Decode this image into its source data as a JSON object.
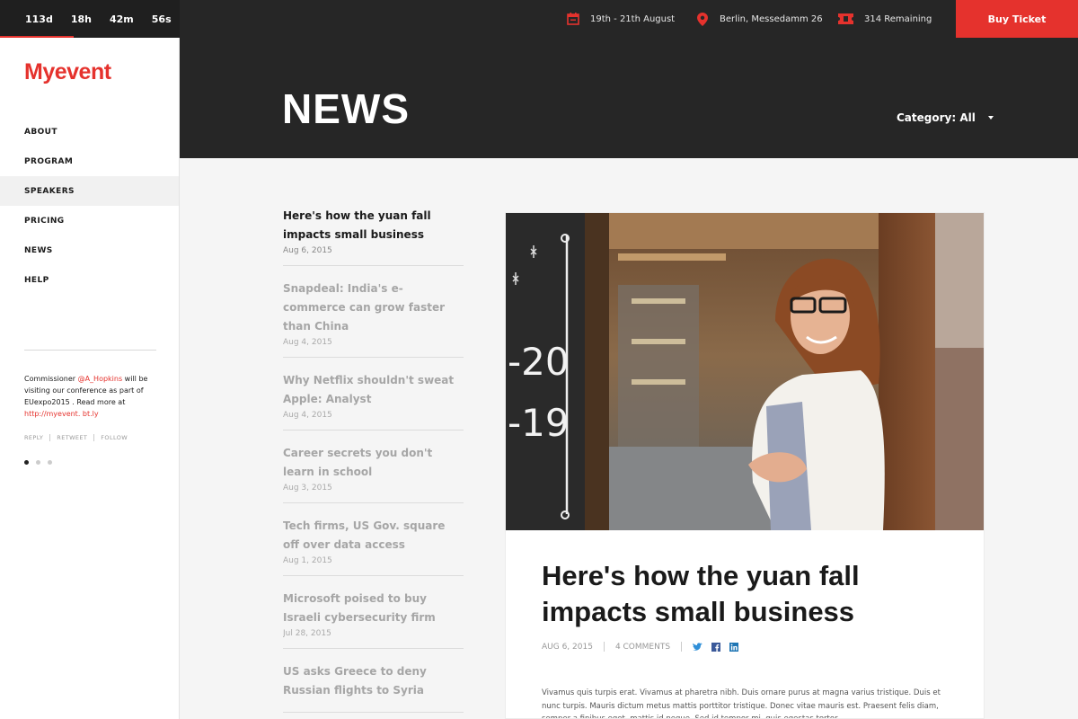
{
  "topbar": {
    "countdown": {
      "days": "113d",
      "hours": "18h",
      "minutes": "42m",
      "seconds": "56s"
    },
    "dates": "19th - 21th August",
    "location": "Berlin, Messedamm 26",
    "remaining": "314 Remaining",
    "buy_label": "Buy Ticket"
  },
  "sidebar": {
    "logo": {
      "part1": "My",
      "part2": "event"
    },
    "nav": [
      "ABOUT",
      "PROGRAM",
      "SPEAKERS",
      "PRICING",
      "NEWS",
      "HELP"
    ],
    "tweet": {
      "pre": "Commissioner ",
      "handle": "@A_Hopkins",
      "mid": " will be visiting our conference as part of EUexpo2015 . Read more at ",
      "link": "http://myevent. bt.ly"
    },
    "tweet_actions": [
      "REPLY",
      "RETWEET",
      "FOLLOW"
    ]
  },
  "header": {
    "title": "NEWS",
    "category": "Category: All"
  },
  "news_list": [
    {
      "title": "Here's how the yuan fall impacts small business",
      "date": "Aug 6, 2015"
    },
    {
      "title": "Snapdeal: India's e-commerce can grow faster than China",
      "date": "Aug 4, 2015"
    },
    {
      "title": "Why Netflix shouldn't sweat Apple: Analyst",
      "date": "Aug 4, 2015"
    },
    {
      "title": "Career secrets you don't learn in school",
      "date": "Aug 3, 2015"
    },
    {
      "title": "Tech firms, US Gov. square off over data access",
      "date": "Aug 1, 2015"
    },
    {
      "title": "Microsoft poised to buy Israeli cybersecurity firm",
      "date": "Jul 28, 2015"
    },
    {
      "title": "US asks Greece to deny Russian flights to Syria",
      "date": ""
    }
  ],
  "article": {
    "title": "Here's how the yuan fall impacts small business",
    "date": "AUG 6, 2015",
    "comments": "4 COMMENTS",
    "body": "Vivamus quis turpis erat. Vivamus at pharetra nibh. Duis ornare purus at magna varius tristique. Duis et nunc turpis. Mauris dictum metus mattis porttitor tristique. Donec vitae mauris est. Praesent felis diam, semper a finibus eget, mattis id neque. Sed id tempor mi, quis egestas tortor.",
    "chalkboard": [
      "-20",
      "-19"
    ]
  },
  "colors": {
    "accent": "#e5322d",
    "dark": "#262626",
    "background": "#f5f5f5"
  }
}
